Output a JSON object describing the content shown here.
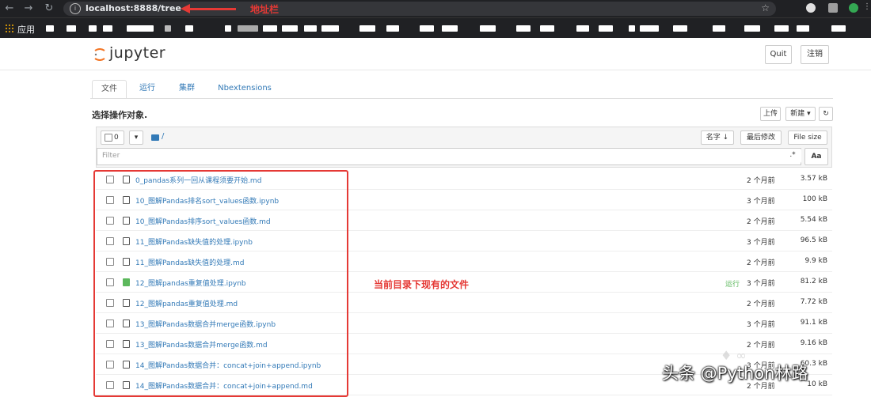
{
  "browser": {
    "url": "localhost:8888/tree",
    "url_annotation": "地址栏",
    "bookmarks_apps_label": "应用"
  },
  "header": {
    "logo_text": "jupyter",
    "quit_label": "Quit",
    "logout_label": "注销"
  },
  "tabs": [
    {
      "label": "文件"
    },
    {
      "label": "运行"
    },
    {
      "label": "集群"
    },
    {
      "label": "Nbextensions"
    }
  ],
  "toolbar": {
    "hint": "选择操作对象.",
    "upload_label": "上传",
    "new_label": "新建 ▾",
    "refresh_icon": "refresh-icon"
  },
  "list_header": {
    "select_count": "0",
    "breadcrumb": "/",
    "sort_name_label": "名字 ↓",
    "sort_modified_label": "最后修改",
    "file_size_label": "File size",
    "filter_placeholder": "Filter",
    "aa_label": "Aa"
  },
  "files": [
    {
      "name": "0_pandas系列一回从课程须要开始.md",
      "status": "",
      "modified": "2 个月前",
      "size": "3.57 kB",
      "running": false
    },
    {
      "name": "10_图解Pandas排名sort_values函数.ipynb",
      "status": "",
      "modified": "3 个月前",
      "size": "100 kB",
      "running": false
    },
    {
      "name": "10_图解Pandas排序sort_values函数.md",
      "status": "",
      "modified": "2 个月前",
      "size": "5.54 kB",
      "running": false
    },
    {
      "name": "11_图解Pandas缺失值的处理.ipynb",
      "status": "",
      "modified": "3 个月前",
      "size": "96.5 kB",
      "running": false
    },
    {
      "name": "11_图解Pandas缺失值的处理.md",
      "status": "",
      "modified": "2 个月前",
      "size": "9.9 kB",
      "running": false
    },
    {
      "name": "12_图解pandas重复值处理.ipynb",
      "status": "运行",
      "modified": "3 个月前",
      "size": "81.2 kB",
      "running": true
    },
    {
      "name": "12_图解pandas重复值处理.md",
      "status": "",
      "modified": "2 个月前",
      "size": "7.72 kB",
      "running": false
    },
    {
      "name": "13_图解Pandas数据合并merge函数.ipynb",
      "status": "",
      "modified": "3 个月前",
      "size": "91.1 kB",
      "running": false
    },
    {
      "name": "13_图解Pandas数据合并merge函数.md",
      "status": "",
      "modified": "2 个月前",
      "size": "9.16 kB",
      "running": false
    },
    {
      "name": "14_图解Pandas数据合并：concat+join+append.ipynb",
      "status": "",
      "modified": "3 个月前",
      "size": "60.3 kB",
      "running": false
    },
    {
      "name": "14_图解Pandas数据合并：concat+join+append.md",
      "status": "",
      "modified": "2 个月前",
      "size": "10 kB",
      "running": false
    }
  ],
  "annotation": "当前目录下现有的文件",
  "watermark": "头条 @Python林路",
  "colors": {
    "accent": "#337ab7",
    "highlight": "#e53935",
    "running": "#5cb85c"
  }
}
